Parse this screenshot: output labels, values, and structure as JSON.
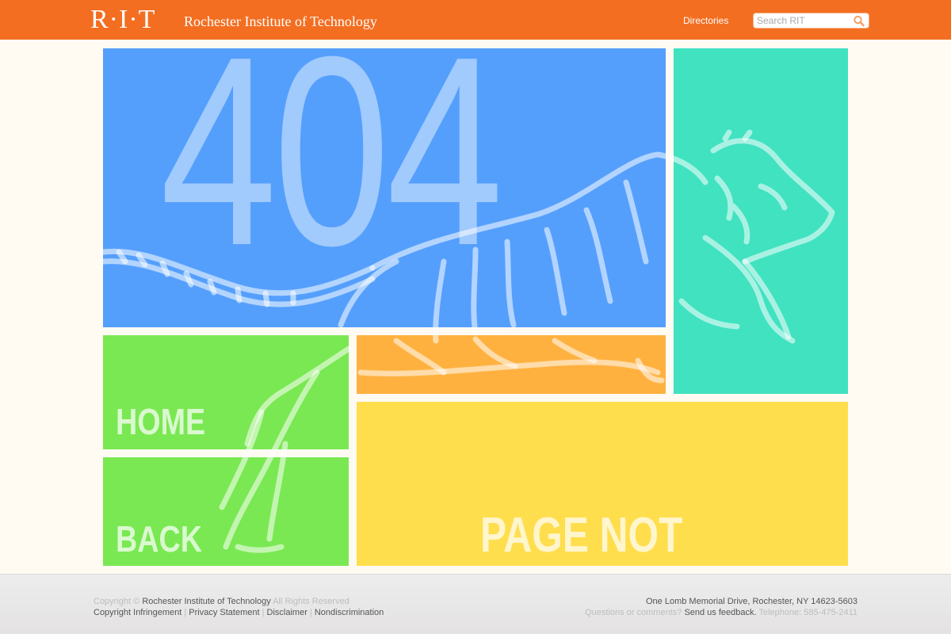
{
  "header": {
    "logo_text": "R·I·T",
    "institution_name": "Rochester Institute of Technology",
    "nav_link": "Directories",
    "search_placeholder": "Search RIT",
    "search_icon": "search-icon",
    "bg_color": "#f36e21"
  },
  "tiles": {
    "error_code": "404",
    "home_label": "HOME",
    "back_label": "BACK",
    "not_found_label": "PAGE NOT FOUND",
    "colors": {
      "blue": "#559ffc",
      "teal": "#40e2c0",
      "green": "#7ae852",
      "orange": "#ffb140",
      "yellow": "#ffde4e"
    }
  },
  "footer": {
    "copyright_prefix": "Copyright ©",
    "copyright_owner": "Rochester Institute of Technology",
    "copyright_suffix": "All Rights Reserved",
    "links": [
      "Copyright Infringement",
      "Privacy Statement",
      "Disclaimer",
      "Nondiscrimination"
    ],
    "address": "One Lomb Memorial Drive, Rochester, NY 14623-5603",
    "questions_text": "Questions or comments?",
    "feedback_link": "Send us feedback.",
    "telephone": "Telephone: 585-475-2411"
  }
}
